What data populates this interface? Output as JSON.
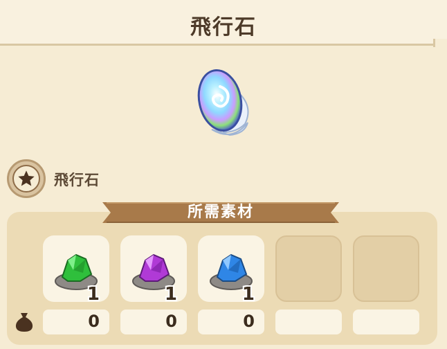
{
  "header": {
    "title": "飛行石"
  },
  "item": {
    "name": "飛行石",
    "image_icon": "flying-stone-icon",
    "badge_icon": "star-icon"
  },
  "materials": {
    "section_title": "所需素材",
    "slots": [
      {
        "icon": "green-crystal-ore-icon",
        "required": "1",
        "owned": "0",
        "color": "#2fbf3c"
      },
      {
        "icon": "purple-crystal-ore-icon",
        "required": "1",
        "owned": "0",
        "color": "#b03ad6"
      },
      {
        "icon": "blue-crystal-ore-icon",
        "required": "1",
        "owned": "0",
        "color": "#2f86e6"
      },
      {
        "icon": "empty-slot",
        "required": "",
        "owned": ""
      },
      {
        "icon": "empty-slot",
        "required": "",
        "owned": ""
      }
    ],
    "owned_icon": "money-bag-icon"
  },
  "colors": {
    "background": "#f6ecd4",
    "panel": "#ecdbb5",
    "ribbon": "#a87a4a",
    "text_dark": "#3b2c1d"
  }
}
